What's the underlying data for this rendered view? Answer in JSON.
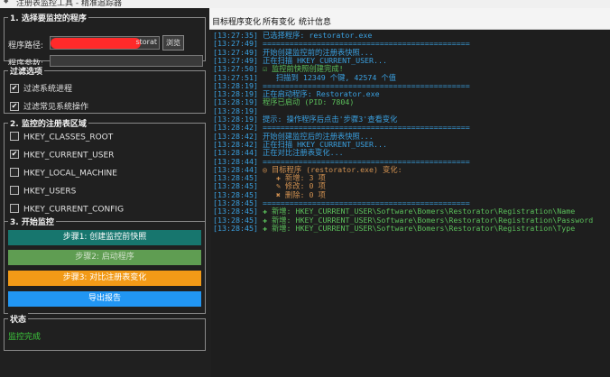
{
  "window": {
    "title": "注册表监控工具 - 精准追踪器"
  },
  "left": {
    "g1": {
      "title": "1. 选择要监控的程序",
      "path_label": "程序路径:",
      "path_value_tail": "storat",
      "browse": "浏览",
      "args_label": "程序参数:"
    },
    "g2": {
      "title": "过滤选项",
      "opt1": "过滤系统进程",
      "opt2": "过滤常见系统操作"
    },
    "g3": {
      "title": "2. 监控的注册表区域",
      "r1": "HKEY_CLASSES_ROOT",
      "r2": "HKEY_CURRENT_USER",
      "r3": "HKEY_LOCAL_MACHINE",
      "r4": "HKEY_USERS",
      "r5": "HKEY_CURRENT_CONFIG"
    },
    "g4": {
      "title": "3. 开始监控",
      "b1": "步骤1: 创建监控前快照",
      "b2": "步骤2: 启动程序",
      "b3": "步骤3: 对比注册表变化",
      "b4": "导出报告"
    },
    "g5": {
      "title": "状态",
      "status": "监控完成"
    }
  },
  "tabs": {
    "t1": "目标程序变化",
    "t2": "所有变化",
    "t3": "统计信息"
  },
  "log": [
    {
      "ts": "[13:27:35]",
      "msg": " 已选择程序: restorator.exe",
      "c": "msg-blue"
    },
    {
      "ts": "[13:27:49]",
      "msg": " ==============================================",
      "c": "msg-blue"
    },
    {
      "ts": "[13:27:49]",
      "msg": " 开始创建监控前的注册表快照...",
      "c": "msg-blue"
    },
    {
      "ts": "[13:27:49]",
      "msg": " 正在扫描 HKEY_CURRENT_USER...",
      "c": "msg-blue"
    },
    {
      "ts": "[13:27:50]",
      "msg": " ☑ 监控前快照创建完成!",
      "c": "msg-green"
    },
    {
      "ts": "[13:27:51]",
      "msg": "    扫描到 12349 个键, 42574 个值",
      "c": "msg-blue"
    },
    {
      "ts": "[13:28:19]",
      "msg": " ==============================================",
      "c": "msg-blue"
    },
    {
      "ts": "[13:28:19]",
      "msg": " 正在启动程序: Restorator.exe",
      "c": "msg-blue"
    },
    {
      "ts": "[13:28:19]",
      "msg": " 程序已启动 (PID: 7804)",
      "c": "msg-green"
    },
    {
      "ts": "[13:28:19]",
      "msg": "",
      "c": "msg-blue"
    },
    {
      "ts": "[13:28:19]",
      "msg": " 提示: 操作程序后点击'步骤3'查看变化",
      "c": "msg-blue"
    },
    {
      "ts": "[13:28:42]",
      "msg": " ==============================================",
      "c": "msg-blue"
    },
    {
      "ts": "[13:28:42]",
      "msg": " 开始创建监控后的注册表快照...",
      "c": "msg-blue"
    },
    {
      "ts": "[13:28:42]",
      "msg": " 正在扫描 HKEY_CURRENT_USER...",
      "c": "msg-blue"
    },
    {
      "ts": "[13:28:44]",
      "msg": " 正在对比注册表变化...",
      "c": "msg-blue"
    },
    {
      "ts": "[13:28:44]",
      "msg": " ==============================================",
      "c": "msg-blue"
    },
    {
      "ts": "[13:28:44]",
      "msg": " ◎ 目标程序 (restorator.exe) 变化:",
      "c": "msg-orange"
    },
    {
      "ts": "[13:28:45]",
      "msg": "    ✚ 新增: 3 项",
      "c": "msg-orange"
    },
    {
      "ts": "[13:28:45]",
      "msg": "    ✎ 修改: 0 项",
      "c": "msg-orange"
    },
    {
      "ts": "[13:28:45]",
      "msg": "    ✖ 删除: 0 项",
      "c": "msg-orange"
    },
    {
      "ts": "[13:28:45]",
      "msg": " ==============================================",
      "c": "msg-blue"
    },
    {
      "ts": "[13:28:45]",
      "msg": " ✚ 新增: HKEY_CURRENT_USER\\Software\\Bomers\\Restorator\\Registration\\Name",
      "c": "msg-green"
    },
    {
      "ts": "[13:28:45]",
      "msg": " ✚ 新增: HKEY_CURRENT_USER\\Software\\Bomers\\Restorator\\Registration\\Password",
      "c": "msg-green"
    },
    {
      "ts": "[13:28:45]",
      "msg": " ✚ 新增: HKEY_CURRENT_USER\\Software\\Bomers\\Restorator\\Registration\\Type",
      "c": "msg-green"
    }
  ],
  "colors": {
    "teal": "#17766e",
    "olive": "#5f9d52",
    "orange": "#f29a17",
    "blue": "#2196f3",
    "status_green": "#3cc93c"
  }
}
